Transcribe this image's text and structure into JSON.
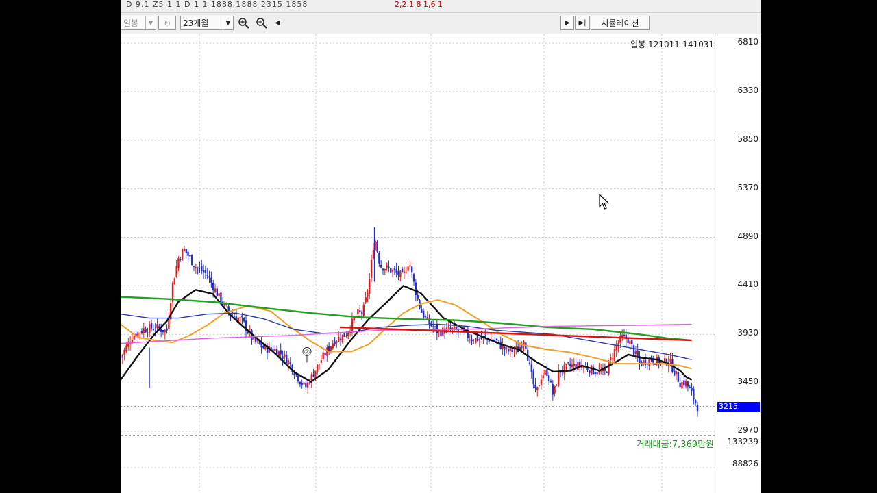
{
  "topbar": {
    "left_text": "D 9.1 Z5 1 1 D 1 1  1888  1888  2315  1858",
    "right_text": "2,2.1 8  1,6   1"
  },
  "toolbar": {
    "period_select": "일봉",
    "range_select": "23개월",
    "simulation_label": "시뮬레이션",
    "icons": [
      "refresh-icon",
      "zoom-in-icon",
      "zoom-out-icon",
      "scroll-left-icon",
      "play-icon",
      "play-to-end-icon"
    ]
  },
  "colors": {
    "candle_up": "#e02020",
    "candle_down": "#2030d0",
    "ma_short_black": "#111111",
    "ma_orange": "#f0a020",
    "ma_green": "#22a022",
    "ma_blue": "#2a3aa8",
    "ma_magenta": "#e060e0",
    "trend_red": "#e01010",
    "last_price_bg": "#0000ff"
  },
  "chart_data": {
    "type": "candlestick",
    "title": "일봉 121011-141031",
    "y_ticks": [
      6810,
      6330,
      5850,
      5370,
      4890,
      4410,
      3930,
      3450,
      2970
    ],
    "ylim": [
      2970,
      6810
    ],
    "last_price": "3215",
    "volume_label": "거래대금:7,369만원",
    "volume_ticks": [
      "133239",
      "88826"
    ],
    "annotation": "②",
    "grid": true,
    "price_path": [
      [
        0,
        3700
      ],
      [
        0.02,
        3910
      ],
      [
        0.04,
        3980
      ],
      [
        0.06,
        4000
      ],
      [
        0.08,
        3960
      ],
      [
        0.09,
        4420
      ],
      [
        0.1,
        4680
      ],
      [
        0.11,
        4770
      ],
      [
        0.13,
        4600
      ],
      [
        0.15,
        4520
      ],
      [
        0.17,
        4300
      ],
      [
        0.19,
        4130
      ],
      [
        0.21,
        4070
      ],
      [
        0.23,
        3870
      ],
      [
        0.25,
        3790
      ],
      [
        0.27,
        3780
      ],
      [
        0.29,
        3670
      ],
      [
        0.31,
        3480
      ],
      [
        0.32,
        3400
      ],
      [
        0.33,
        3500
      ],
      [
        0.35,
        3700
      ],
      [
        0.37,
        3870
      ],
      [
        0.39,
        3930
      ],
      [
        0.41,
        4130
      ],
      [
        0.42,
        4150
      ],
      [
        0.43,
        4400
      ],
      [
        0.44,
        4900
      ],
      [
        0.45,
        4610
      ],
      [
        0.47,
        4560
      ],
      [
        0.49,
        4500
      ],
      [
        0.5,
        4660
      ],
      [
        0.51,
        4390
      ],
      [
        0.52,
        4170
      ],
      [
        0.53,
        4070
      ],
      [
        0.55,
        3950
      ],
      [
        0.57,
        3980
      ],
      [
        0.59,
        3960
      ],
      [
        0.61,
        3880
      ],
      [
        0.63,
        3890
      ],
      [
        0.65,
        3870
      ],
      [
        0.67,
        3760
      ],
      [
        0.69,
        3780
      ],
      [
        0.7,
        3900
      ],
      [
        0.71,
        3570
      ],
      [
        0.72,
        3330
      ],
      [
        0.73,
        3530
      ],
      [
        0.74,
        3560
      ],
      [
        0.75,
        3320
      ],
      [
        0.76,
        3560
      ],
      [
        0.78,
        3620
      ],
      [
        0.8,
        3620
      ],
      [
        0.82,
        3570
      ],
      [
        0.84,
        3550
      ],
      [
        0.86,
        3820
      ],
      [
        0.87,
        3900
      ],
      [
        0.88,
        3880
      ],
      [
        0.9,
        3640
      ],
      [
        0.92,
        3690
      ],
      [
        0.94,
        3640
      ],
      [
        0.95,
        3680
      ],
      [
        0.96,
        3560
      ],
      [
        0.97,
        3450
      ],
      [
        0.98,
        3450
      ],
      [
        0.99,
        3340
      ],
      [
        1,
        3215
      ]
    ],
    "series": [
      {
        "name": "",
        "color": "#111111",
        "values": [
          [
            0,
            3480
          ],
          [
            0.03,
            3720
          ],
          [
            0.06,
            3940
          ],
          [
            0.08,
            4060
          ],
          [
            0.1,
            4250
          ],
          [
            0.13,
            4370
          ],
          [
            0.16,
            4330
          ],
          [
            0.19,
            4120
          ],
          [
            0.23,
            3920
          ],
          [
            0.27,
            3730
          ],
          [
            0.3,
            3560
          ],
          [
            0.33,
            3460
          ],
          [
            0.36,
            3580
          ],
          [
            0.4,
            3880
          ],
          [
            0.43,
            4080
          ],
          [
            0.46,
            4240
          ],
          [
            0.49,
            4410
          ],
          [
            0.52,
            4340
          ],
          [
            0.56,
            4090
          ],
          [
            0.6,
            3970
          ],
          [
            0.63,
            3900
          ],
          [
            0.66,
            3830
          ],
          [
            0.69,
            3780
          ],
          [
            0.72,
            3660
          ],
          [
            0.75,
            3560
          ],
          [
            0.78,
            3570
          ],
          [
            0.8,
            3620
          ],
          [
            0.83,
            3570
          ],
          [
            0.86,
            3660
          ],
          [
            0.88,
            3730
          ],
          [
            0.9,
            3700
          ],
          [
            0.93,
            3680
          ],
          [
            0.95,
            3640
          ],
          [
            0.97,
            3570
          ],
          [
            0.98,
            3510
          ],
          [
            0.99,
            3480
          ]
        ]
      },
      {
        "name": "",
        "color": "#f0a020",
        "values": [
          [
            0,
            4030
          ],
          [
            0.03,
            3900
          ],
          [
            0.06,
            3870
          ],
          [
            0.09,
            3850
          ],
          [
            0.12,
            3920
          ],
          [
            0.15,
            4020
          ],
          [
            0.18,
            4140
          ],
          [
            0.22,
            4210
          ],
          [
            0.26,
            4160
          ],
          [
            0.29,
            4020
          ],
          [
            0.33,
            3860
          ],
          [
            0.36,
            3760
          ],
          [
            0.4,
            3760
          ],
          [
            0.43,
            3830
          ],
          [
            0.46,
            3990
          ],
          [
            0.49,
            4140
          ],
          [
            0.52,
            4230
          ],
          [
            0.55,
            4270
          ],
          [
            0.58,
            4220
          ],
          [
            0.62,
            4080
          ],
          [
            0.66,
            3930
          ],
          [
            0.7,
            3820
          ],
          [
            0.74,
            3780
          ],
          [
            0.78,
            3750
          ],
          [
            0.82,
            3700
          ],
          [
            0.86,
            3640
          ],
          [
            0.9,
            3640
          ],
          [
            0.94,
            3640
          ],
          [
            0.97,
            3620
          ],
          [
            0.99,
            3590
          ]
        ]
      },
      {
        "name": "",
        "color": "#2a3aa8",
        "values": [
          [
            0,
            4130
          ],
          [
            0.05,
            4090
          ],
          [
            0.1,
            4090
          ],
          [
            0.15,
            4130
          ],
          [
            0.2,
            4140
          ],
          [
            0.25,
            4080
          ],
          [
            0.3,
            3980
          ],
          [
            0.35,
            3940
          ],
          [
            0.4,
            3950
          ],
          [
            0.45,
            4000
          ],
          [
            0.5,
            4020
          ],
          [
            0.55,
            4030
          ],
          [
            0.6,
            4010
          ],
          [
            0.65,
            3970
          ],
          [
            0.7,
            3950
          ],
          [
            0.75,
            3930
          ],
          [
            0.8,
            3880
          ],
          [
            0.85,
            3830
          ],
          [
            0.9,
            3780
          ],
          [
            0.95,
            3730
          ],
          [
            0.99,
            3680
          ]
        ]
      },
      {
        "name": "",
        "color": "#22a022",
        "values": [
          [
            0,
            4300
          ],
          [
            0.08,
            4280
          ],
          [
            0.16,
            4250
          ],
          [
            0.25,
            4190
          ],
          [
            0.33,
            4140
          ],
          [
            0.41,
            4100
          ],
          [
            0.5,
            4080
          ],
          [
            0.58,
            4070
          ],
          [
            0.66,
            4040
          ],
          [
            0.74,
            4000
          ],
          [
            0.82,
            3980
          ],
          [
            0.9,
            3930
          ],
          [
            0.95,
            3890
          ],
          [
            0.99,
            3870
          ]
        ]
      },
      {
        "name": "",
        "color": "#e060e0",
        "values": [
          [
            0,
            3840
          ],
          [
            0.15,
            3890
          ],
          [
            0.3,
            3920
          ],
          [
            0.45,
            3970
          ],
          [
            0.6,
            3980
          ],
          [
            0.75,
            4010
          ],
          [
            0.9,
            4020
          ],
          [
            0.99,
            4030
          ]
        ]
      },
      {
        "name": "",
        "color": "#e01010",
        "values": [
          [
            0.38,
            4000
          ],
          [
            0.99,
            3870
          ]
        ]
      }
    ]
  }
}
